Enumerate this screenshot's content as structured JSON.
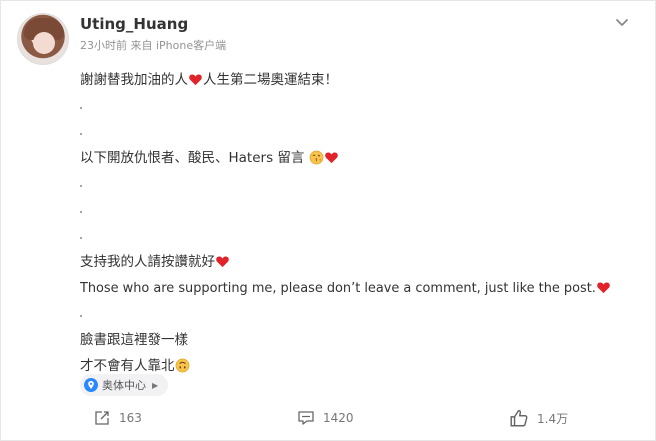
{
  "post": {
    "username": "Uting_Huang",
    "time": "23小时前",
    "source": "来自 iPhone客户端",
    "lines": [
      {
        "type": "text",
        "text": "謝謝替我加油的人",
        "emoji_after": "heart",
        "text2": "人生第二場奧運結束！"
      },
      {
        "type": "dot"
      },
      {
        "type": "dot"
      },
      {
        "type": "text",
        "text": "以下開放仇恨者、酸民、Haters 留言",
        "emojis": [
          "kiss-face",
          "heart"
        ]
      },
      {
        "type": "dot"
      },
      {
        "type": "dot"
      },
      {
        "type": "dot"
      },
      {
        "type": "text",
        "text": "支持我的人請按讚就好",
        "emojis": [
          "heart"
        ]
      },
      {
        "type": "text",
        "text": "Those who are supporting me, please don’t leave a comment, just like the post.",
        "emojis": [
          "heart"
        ]
      },
      {
        "type": "dot"
      },
      {
        "type": "text",
        "text": "臉書跟這裡發一樣"
      },
      {
        "type": "text",
        "text": "才不會有人靠北",
        "emojis": [
          "upside-down-face"
        ]
      }
    ],
    "location": "奥体中心",
    "location_icon": "location-pin-icon",
    "actions": {
      "repost_count": "163",
      "comment_count": "1420",
      "like_count": "1.4万"
    }
  },
  "colors": {
    "accent_blue": "#2b88ff",
    "heart_red": "#e0242a",
    "meta_gray": "#939393"
  }
}
